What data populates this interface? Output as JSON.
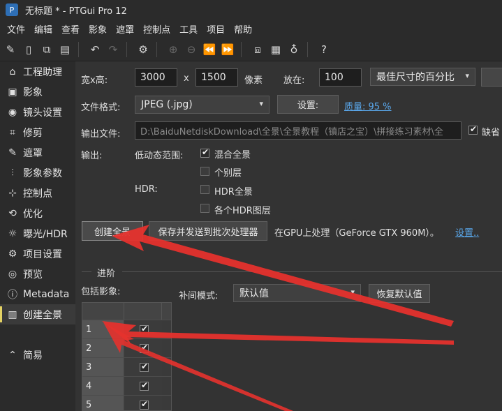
{
  "window": {
    "title": "无标题 * - PTGui Pro 12",
    "app_icon": "P"
  },
  "menu": [
    "文件",
    "编辑",
    "查看",
    "影象",
    "遮罩",
    "控制点",
    "工具",
    "项目",
    "帮助"
  ],
  "sidebar": {
    "items": [
      {
        "label": "工程助理",
        "icon": "home-icon",
        "glyph": "⌂"
      },
      {
        "label": "影象",
        "icon": "image-icon",
        "glyph": "▣"
      },
      {
        "label": "镜头设置",
        "icon": "camera-icon",
        "glyph": "◉"
      },
      {
        "label": "修剪",
        "icon": "crop-icon",
        "glyph": "⌗"
      },
      {
        "label": "遮罩",
        "icon": "brush-icon",
        "glyph": "✎"
      },
      {
        "label": "影象参数",
        "icon": "sliders-icon",
        "glyph": "⫶"
      },
      {
        "label": "控制点",
        "icon": "control-points-icon",
        "glyph": "⊹"
      },
      {
        "label": "优化",
        "icon": "optimize-icon",
        "glyph": "⟲"
      },
      {
        "label": "曝光/HDR",
        "icon": "sun-icon",
        "glyph": "☼"
      },
      {
        "label": "项目设置",
        "icon": "gear-icon",
        "glyph": "⚙"
      },
      {
        "label": "预览",
        "icon": "eye-icon",
        "glyph": "◎"
      },
      {
        "label": "Metadata",
        "icon": "info-icon",
        "glyph": "ⓘ"
      },
      {
        "label": "创建全景",
        "icon": "panorama-icon",
        "glyph": "▥"
      }
    ],
    "simple": {
      "label": "简易",
      "icon": "chevron-up-circle-icon",
      "glyph": "⌃"
    }
  },
  "main": {
    "size_label": "宽x高:",
    "width_value": "3000",
    "x_sep": "x",
    "height_value": "1500",
    "pixel_unit": "像素",
    "zoom_label": "放在:",
    "zoom_value": "100",
    "zoom_mode": "最佳尺寸的百分比",
    "format_label": "文件格式:",
    "format_value": "JPEG (.jpg)",
    "settings_button": "设置:",
    "quality_link": "质量: 95 %",
    "output_label": "输出文件:",
    "output_path": "D:\\BaiduNetdiskDownload\\全景\\全景教程（镇店之宝）\\拼接练习素材\\全",
    "default_label": "缺省",
    "output_type_label": "输出:",
    "ldr_label": "低动态范围:",
    "blended": "混合全景",
    "individual_layers": "个别层",
    "hdr_label": "HDR:",
    "hdr_panorama": "HDR全景",
    "hdr_layers": "各个HDR图层",
    "create_button": "创建全景",
    "batch_button": "保存并发送到批次处理器",
    "gpu_text": "在GPU上处理（GeForce GTX 960M）。",
    "gpu_settings_link": "设置..",
    "advanced_title": "进阶",
    "include_label": "包括影象:",
    "interp_label": "补间模式:",
    "interp_value": "默认值",
    "restore_button": "恢复默认值",
    "images": [
      "1",
      "2",
      "3",
      "4",
      "5"
    ]
  },
  "colors": {
    "accent": "#e4d264",
    "link": "#5aa8ec",
    "arrow": "#e5322d"
  }
}
